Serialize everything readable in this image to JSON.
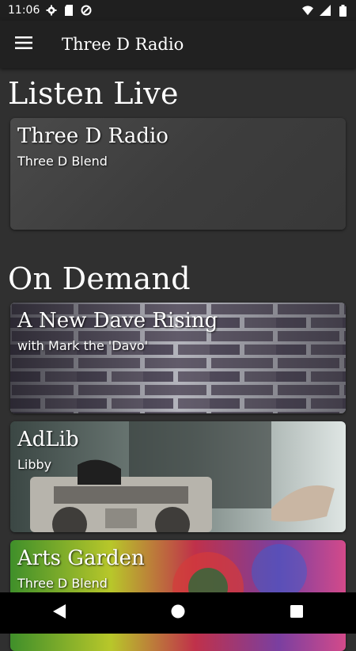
{
  "status_bar": {
    "time": "11:06"
  },
  "app_bar": {
    "title": "Three D Radio"
  },
  "listen_live": {
    "heading": "Listen Live",
    "station": {
      "title": "Three D Radio",
      "subtitle": "Three D Blend"
    }
  },
  "on_demand": {
    "heading": "On Demand",
    "shows": [
      {
        "title": "A New Dave Rising",
        "subtitle": "with Mark the 'Davo'"
      },
      {
        "title": "AdLib",
        "subtitle": "Libby"
      },
      {
        "title": "Arts Garden",
        "subtitle": "Three D Blend"
      }
    ]
  },
  "icons": {
    "menu": "hamburger-menu-icon",
    "settings": "gear-icon",
    "sd": "sd-card-icon",
    "sync": "sync-icon",
    "wifi": "wifi-icon",
    "signal": "cell-signal-icon",
    "battery": "battery-icon",
    "back": "back-triangle-icon",
    "home": "home-circle-icon",
    "recents": "recents-square-icon"
  }
}
